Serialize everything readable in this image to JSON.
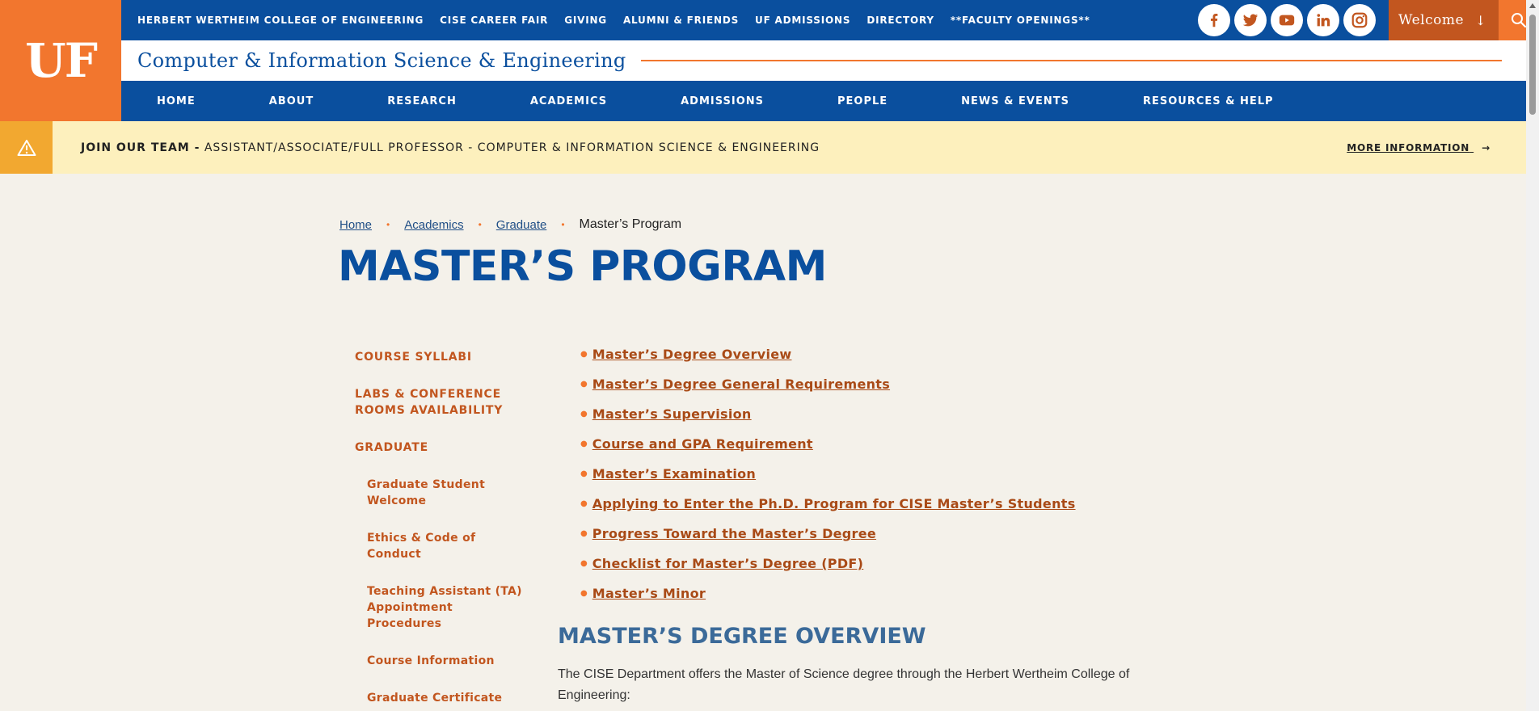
{
  "logo": {
    "text": "UF"
  },
  "topbar": {
    "links": [
      "HERBERT WERTHEIM COLLEGE OF ENGINEERING",
      "CISE CAREER FAIR",
      "GIVING",
      "ALUMNI & FRIENDS",
      "UF ADMISSIONS",
      "DIRECTORY",
      "**FACULTY OPENINGS**"
    ],
    "social_icons": [
      "facebook-icon",
      "twitter-icon",
      "youtube-icon",
      "linkedin-icon",
      "instagram-icon"
    ],
    "welcome_label": "Welcome",
    "welcome_arrow": "↓"
  },
  "site": {
    "title": "Computer & Information Science & Engineering"
  },
  "mainnav": {
    "items": [
      "HOME",
      "ABOUT",
      "RESEARCH",
      "ACADEMICS",
      "ADMISSIONS",
      "PEOPLE",
      "NEWS & EVENTS",
      "RESOURCES & HELP"
    ]
  },
  "alert": {
    "bold_text": "JOIN OUR TEAM -",
    "text": " ASSISTANT/ASSOCIATE/FULL PROFESSOR - COMPUTER & INFORMATION SCIENCE & ENGINEERING",
    "more_label": "MORE INFORMATION",
    "more_arrow": "→"
  },
  "breadcrumb": {
    "items": [
      "Home",
      "Academics",
      "Graduate"
    ],
    "separator": "•",
    "current": "Master’s Program"
  },
  "page": {
    "title": "MASTER’S PROGRAM"
  },
  "sidebar": {
    "items": [
      "COURSE SYLLABI",
      "LABS & CONFERENCE ROOMS AVAILABILITY",
      "GRADUATE"
    ],
    "subitems": [
      "Graduate Student Welcome",
      "Ethics & Code of Conduct",
      "Teaching Assistant (TA) Appointment Procedures",
      "Course Information",
      "Graduate Certificate"
    ]
  },
  "toc": {
    "bullet": "●",
    "items": [
      "Master’s Degree Overview",
      "Master’s Degree General Requirements",
      "Master’s Supervision",
      "Course and GPA Requirement",
      "Master’s Examination",
      "Applying to Enter the Ph.D. Program for CISE Master’s Students",
      "Progress Toward the Master’s Degree",
      "Checklist for Master’s Degree (PDF)",
      "Master’s Minor"
    ]
  },
  "section": {
    "title": "MASTER’S DEGREE OVERVIEW",
    "paragraph": "The CISE Department offers the Master of Science degree through the Herbert Wertheim College of Engineering:"
  },
  "colors": {
    "uf_orange": "#f2762e",
    "uf_blue": "#0a4f9e",
    "link_orange": "#c2561f",
    "alert_bg": "#fdf0bd",
    "alert_icon_bg": "#f2a830"
  }
}
